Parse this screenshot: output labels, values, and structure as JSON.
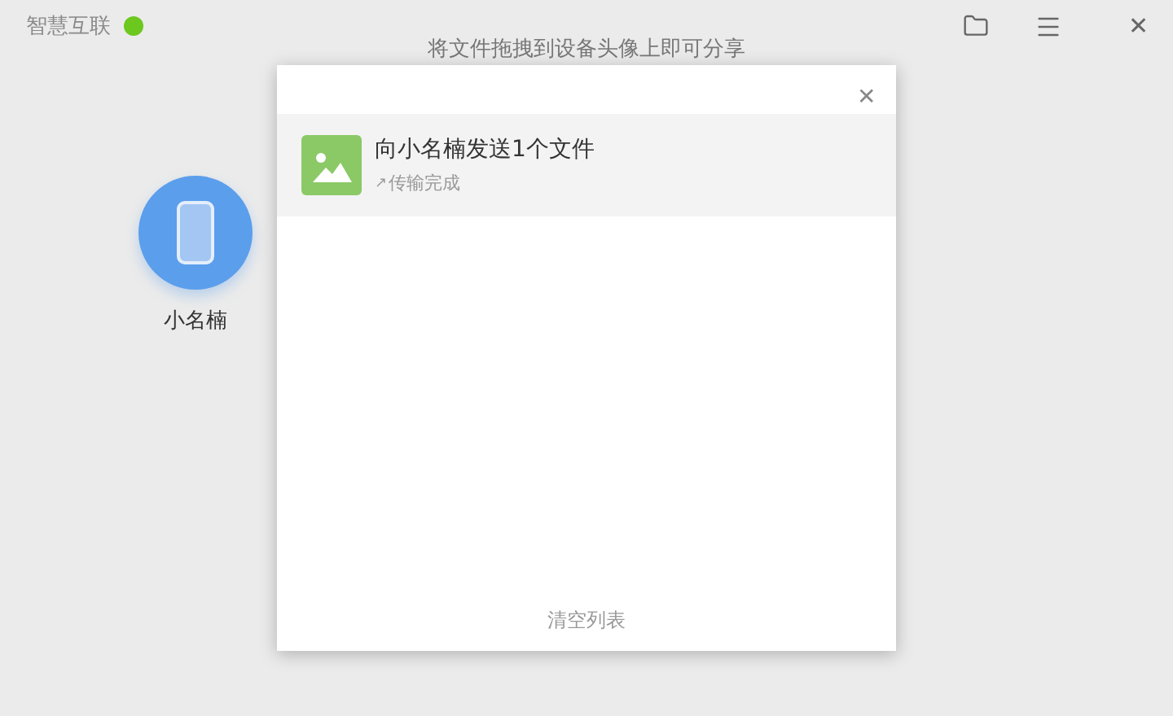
{
  "app": {
    "title": "智慧互联",
    "online": true
  },
  "toolbar": {
    "close": "✕"
  },
  "hint": "将文件拖拽到设备头像上即可分享",
  "devices": [
    {
      "name": "小名楠"
    }
  ],
  "dialog": {
    "close": "✕",
    "transfers": [
      {
        "title": "向小名楠发送1个文件",
        "status_arrow": "↗",
        "status": "传输完成"
      }
    ],
    "clear": "清空列表"
  }
}
